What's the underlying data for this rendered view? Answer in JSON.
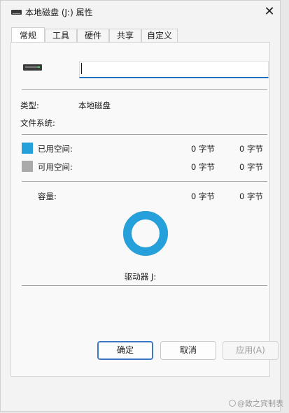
{
  "window": {
    "title": "本地磁盘 (J:) 属性",
    "close_glyph": "✕"
  },
  "tabs": [
    {
      "label": "常规",
      "active": true
    },
    {
      "label": "工具",
      "active": false
    },
    {
      "label": "硬件",
      "active": false
    },
    {
      "label": "共享",
      "active": false
    },
    {
      "label": "自定义",
      "active": false
    }
  ],
  "general": {
    "drive_icon": "drive-icon",
    "name_value": "",
    "type_label": "类型:",
    "type_value": "本地磁盘",
    "fs_label": "文件系统:",
    "fs_value": "",
    "used": {
      "label": "已用空间:",
      "bytes": "0 字节",
      "size": "0 字节",
      "color": "#26a0da"
    },
    "free": {
      "label": "可用空间:",
      "bytes": "0 字节",
      "size": "0 字节",
      "color": "#aaaaaa"
    },
    "capacity": {
      "label": "容量:",
      "bytes": "0 字节",
      "size": "0 字节"
    },
    "drive_label": "驱动器 J:",
    "usage_fraction": 0
  },
  "buttons": {
    "ok": "确定",
    "cancel": "取消",
    "apply": "应用(A)"
  },
  "watermark": "@致之宾制表"
}
